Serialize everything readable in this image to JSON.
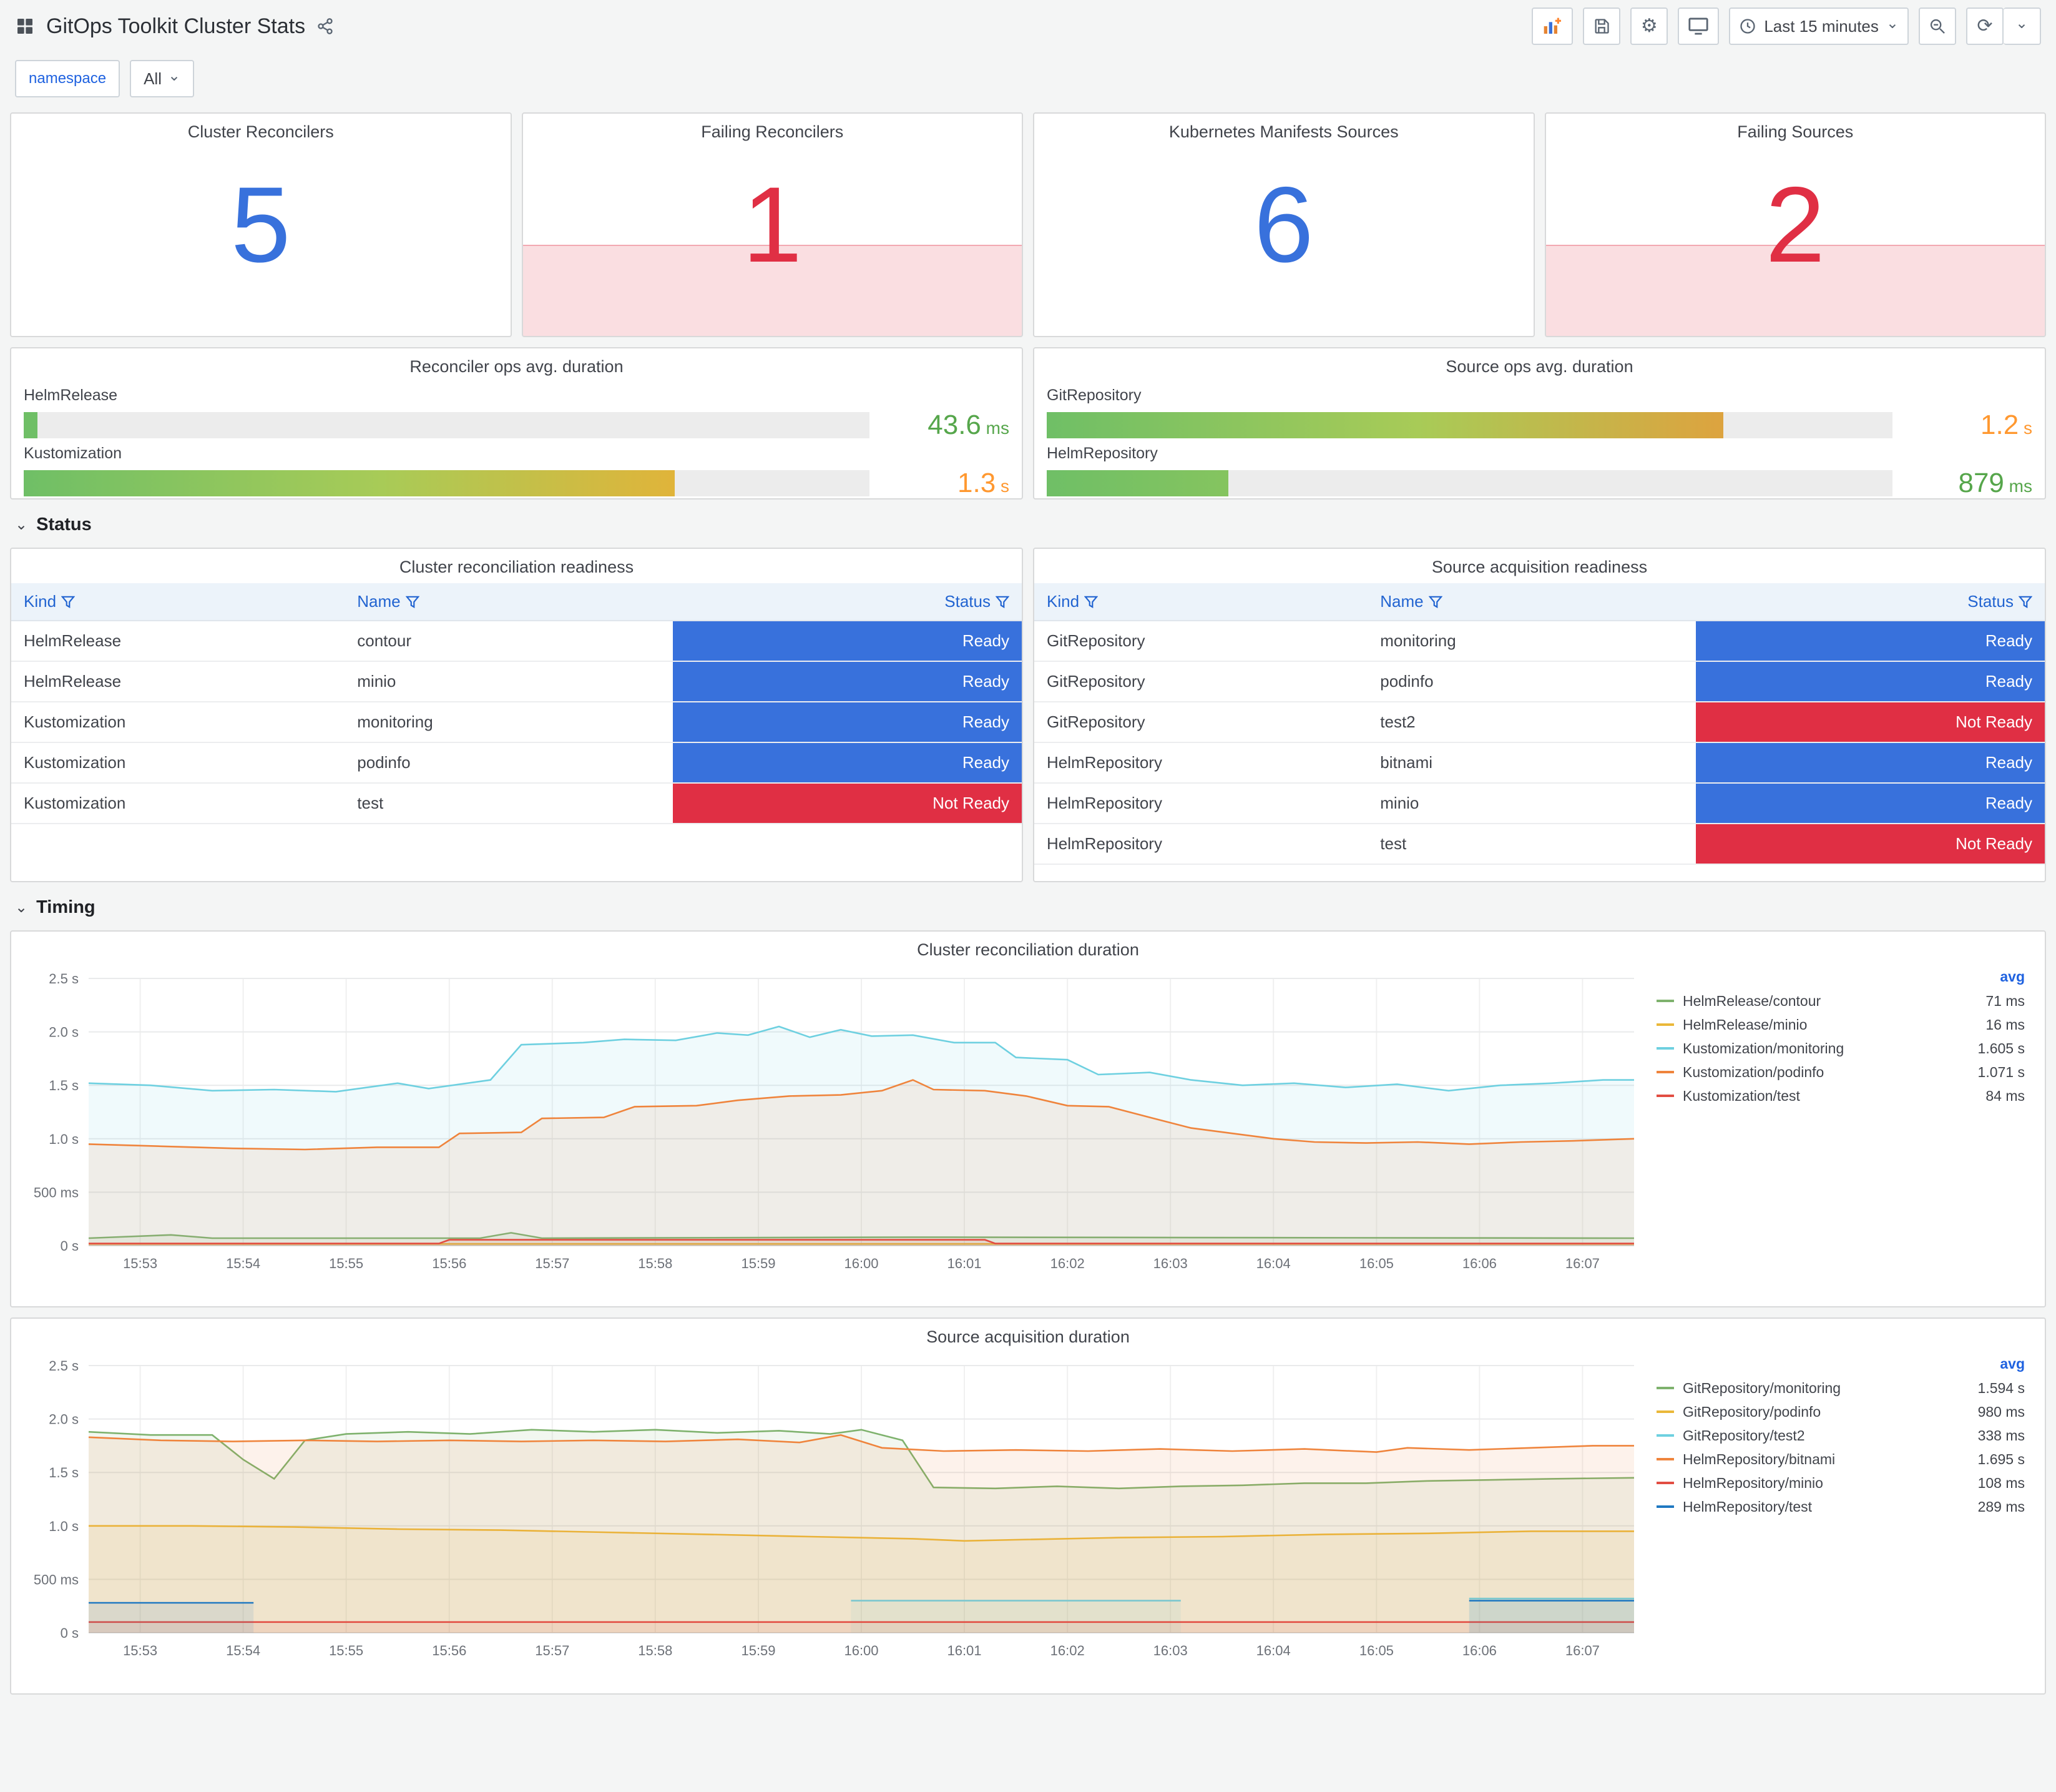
{
  "colors": {
    "blue": "#3871dc",
    "red": "#e02f44",
    "green_value": "#56a64b",
    "orange_value": "#ff9830",
    "ready_bg": "#3871dc",
    "not_ready_bg": "#e02f44"
  },
  "icons": {
    "grid": "dashboard-grid-icon",
    "share": "share-icon",
    "add_panel": "add-panel-icon",
    "save": "save-icon",
    "settings": "⚙",
    "kiosk": "tv-kiosk-icon",
    "clock": "clock-icon",
    "zoom_out": "zoom-out-icon",
    "refresh": "⟳",
    "chevron_down": "⌄",
    "filter": "filter-funnel-icon"
  },
  "header": {
    "title": "GitOps Toolkit Cluster Stats"
  },
  "toolbar": {
    "time_range": "Last 15 minutes"
  },
  "filters": {
    "namespace_label": "namespace",
    "namespace_value": "All"
  },
  "sections": {
    "status": "Status",
    "timing": "Timing"
  },
  "stat_panels": [
    {
      "title": "Cluster Reconcilers",
      "value": "5",
      "state": "ok"
    },
    {
      "title": "Failing Reconcilers",
      "value": "1",
      "state": "alert"
    },
    {
      "title": "Kubernetes Manifests Sources",
      "value": "6",
      "state": "ok"
    },
    {
      "title": "Failing Sources",
      "value": "2",
      "state": "alert"
    }
  ],
  "gauges": [
    {
      "title": "Reconciler ops avg. duration",
      "bars": [
        {
          "label": "HelmRelease",
          "value": "43.6",
          "unit": "ms",
          "pct": 1.6,
          "value_color": "#56a64b",
          "fill": "linear-gradient(90deg,#6fbf66,#6fbf66)"
        },
        {
          "label": "Kustomization",
          "value": "1.3",
          "unit": "s",
          "pct": 77,
          "value_color": "#ff9830",
          "fill": "linear-gradient(90deg,#6fbf66,#a8cb57 55%,#e0b43a 100%)"
        }
      ]
    },
    {
      "title": "Source ops avg. duration",
      "bars": [
        {
          "label": "GitRepository",
          "value": "1.2",
          "unit": "s",
          "pct": 80,
          "value_color": "#ff9830",
          "fill": "linear-gradient(90deg,#6fbf66,#a8cb57 55%,#dda33f 100%)"
        },
        {
          "label": "HelmRepository",
          "value": "879",
          "unit": "ms",
          "pct": 21.5,
          "value_color": "#56a64b",
          "fill": "linear-gradient(90deg,#6fbf66,#85c45f)"
        }
      ]
    }
  ],
  "status_section": {
    "tables": [
      {
        "title": "Cluster reconciliation readiness",
        "columns": [
          "Kind",
          "Name",
          "Status"
        ],
        "rows": [
          [
            "HelmRelease",
            "contour",
            "Ready"
          ],
          [
            "HelmRelease",
            "minio",
            "Ready"
          ],
          [
            "Kustomization",
            "monitoring",
            "Ready"
          ],
          [
            "Kustomization",
            "podinfo",
            "Ready"
          ],
          [
            "Kustomization",
            "test",
            "Not Ready"
          ]
        ]
      },
      {
        "title": "Source acquisition readiness",
        "columns": [
          "Kind",
          "Name",
          "Status"
        ],
        "rows": [
          [
            "GitRepository",
            "monitoring",
            "Ready"
          ],
          [
            "GitRepository",
            "podinfo",
            "Ready"
          ],
          [
            "GitRepository",
            "test2",
            "Not Ready"
          ],
          [
            "HelmRepository",
            "bitnami",
            "Ready"
          ],
          [
            "HelmRepository",
            "minio",
            "Ready"
          ],
          [
            "HelmRepository",
            "test",
            "Not Ready"
          ]
        ]
      }
    ]
  },
  "chart_data": [
    {
      "type": "line",
      "title": "Cluster reconciliation duration",
      "xlabel": "",
      "ylabel": "",
      "ylim": [
        0,
        2.5
      ],
      "grid": true,
      "legend_position": "right",
      "legend_header": "avg",
      "y_ticks": [
        {
          "v": 0,
          "label": "0 s"
        },
        {
          "v": 0.5,
          "label": "500 ms"
        },
        {
          "v": 1,
          "label": "1.0 s"
        },
        {
          "v": 1.5,
          "label": "1.5 s"
        },
        {
          "v": 2,
          "label": "2.0 s"
        },
        {
          "v": 2.5,
          "label": "2.5 s"
        }
      ],
      "x_tick_labels": [
        "15:53",
        "15:54",
        "15:55",
        "15:56",
        "15:57",
        "15:58",
        "15:59",
        "16:00",
        "16:01",
        "16:02",
        "16:03",
        "16:04",
        "16:05",
        "16:06",
        "16:07"
      ],
      "series": [
        {
          "name": "HelmRelease/contour",
          "color": "#7EB26D",
          "avg": "71 ms",
          "points": [
            [
              0,
              0.07
            ],
            [
              0.8,
              0.1
            ],
            [
              1.2,
              0.07
            ],
            [
              3.8,
              0.07
            ],
            [
              4.1,
              0.12
            ],
            [
              4.4,
              0.07
            ],
            [
              8,
              0.08
            ],
            [
              15,
              0.07
            ]
          ]
        },
        {
          "name": "HelmRelease/minio",
          "color": "#EAB839",
          "avg": "16 ms",
          "points": [
            [
              0,
              0.016
            ],
            [
              15,
              0.016
            ]
          ]
        },
        {
          "name": "Kustomization/monitoring",
          "color": "#6ED0E0",
          "avg": "1.605 s",
          "points": [
            [
              0,
              1.52
            ],
            [
              0.6,
              1.5
            ],
            [
              1.2,
              1.45
            ],
            [
              1.8,
              1.46
            ],
            [
              2.4,
              1.44
            ],
            [
              3,
              1.52
            ],
            [
              3.3,
              1.47
            ],
            [
              3.9,
              1.55
            ],
            [
              4.2,
              1.88
            ],
            [
              4.8,
              1.9
            ],
            [
              5.2,
              1.93
            ],
            [
              5.7,
              1.92
            ],
            [
              6.1,
              1.99
            ],
            [
              6.4,
              1.97
            ],
            [
              6.7,
              2.05
            ],
            [
              7,
              1.95
            ],
            [
              7.3,
              2.02
            ],
            [
              7.6,
              1.96
            ],
            [
              8,
              1.97
            ],
            [
              8.4,
              1.9
            ],
            [
              8.8,
              1.9
            ],
            [
              9,
              1.76
            ],
            [
              9.5,
              1.74
            ],
            [
              9.8,
              1.6
            ],
            [
              10.3,
              1.62
            ],
            [
              10.7,
              1.55
            ],
            [
              11.2,
              1.5
            ],
            [
              11.7,
              1.52
            ],
            [
              12.2,
              1.48
            ],
            [
              12.7,
              1.51
            ],
            [
              13.2,
              1.45
            ],
            [
              13.7,
              1.5
            ],
            [
              14.2,
              1.52
            ],
            [
              14.7,
              1.55
            ],
            [
              15,
              1.55
            ]
          ]
        },
        {
          "name": "Kustomization/podinfo",
          "color": "#EF843C",
          "avg": "1.071 s",
          "points": [
            [
              0,
              0.95
            ],
            [
              0.7,
              0.93
            ],
            [
              1.4,
              0.91
            ],
            [
              2.1,
              0.9
            ],
            [
              2.8,
              0.92
            ],
            [
              3.4,
              0.92
            ],
            [
              3.6,
              1.05
            ],
            [
              4.2,
              1.06
            ],
            [
              4.4,
              1.19
            ],
            [
              5,
              1.2
            ],
            [
              5.3,
              1.3
            ],
            [
              5.9,
              1.31
            ],
            [
              6.3,
              1.36
            ],
            [
              6.8,
              1.4
            ],
            [
              7.3,
              1.41
            ],
            [
              7.7,
              1.45
            ],
            [
              8,
              1.55
            ],
            [
              8.2,
              1.46
            ],
            [
              8.7,
              1.45
            ],
            [
              9.1,
              1.4
            ],
            [
              9.5,
              1.31
            ],
            [
              9.9,
              1.3
            ],
            [
              10.3,
              1.2
            ],
            [
              10.7,
              1.1
            ],
            [
              11.1,
              1.05
            ],
            [
              11.5,
              1
            ],
            [
              11.9,
              0.97
            ],
            [
              12.4,
              0.96
            ],
            [
              12.9,
              0.97
            ],
            [
              13.4,
              0.95
            ],
            [
              13.9,
              0.97
            ],
            [
              14.4,
              0.98
            ],
            [
              15,
              1
            ]
          ]
        },
        {
          "name": "Kustomization/test",
          "color": "#E24D42",
          "avg": "84 ms",
          "points": [
            [
              0,
              0.02
            ],
            [
              3.4,
              0.02
            ],
            [
              3.5,
              0.055
            ],
            [
              8.7,
              0.055
            ],
            [
              8.8,
              0.02
            ],
            [
              15,
              0.02
            ]
          ]
        }
      ]
    },
    {
      "type": "line",
      "title": "Source acquisition duration",
      "xlabel": "",
      "ylabel": "",
      "ylim": [
        0,
        2.5
      ],
      "grid": true,
      "legend_position": "right",
      "legend_header": "avg",
      "y_ticks": [
        {
          "v": 0,
          "label": "0 s"
        },
        {
          "v": 0.5,
          "label": "500 ms"
        },
        {
          "v": 1,
          "label": "1.0 s"
        },
        {
          "v": 1.5,
          "label": "1.5 s"
        },
        {
          "v": 2,
          "label": "2.0 s"
        },
        {
          "v": 2.5,
          "label": "2.5 s"
        }
      ],
      "x_tick_labels": [
        "15:53",
        "15:54",
        "15:55",
        "15:56",
        "15:57",
        "15:58",
        "15:59",
        "16:00",
        "16:01",
        "16:02",
        "16:03",
        "16:04",
        "16:05",
        "16:06",
        "16:07"
      ],
      "series": [
        {
          "name": "GitRepository/monitoring",
          "color": "#7EB26D",
          "avg": "1.594 s",
          "points": [
            [
              0,
              1.88
            ],
            [
              0.6,
              1.85
            ],
            [
              1.2,
              1.85
            ],
            [
              1.5,
              1.62
            ],
            [
              1.8,
              1.44
            ],
            [
              2.1,
              1.8
            ],
            [
              2.5,
              1.86
            ],
            [
              3.1,
              1.88
            ],
            [
              3.7,
              1.86
            ],
            [
              4.3,
              1.9
            ],
            [
              4.9,
              1.88
            ],
            [
              5.5,
              1.9
            ],
            [
              6.1,
              1.87
            ],
            [
              6.7,
              1.89
            ],
            [
              7.2,
              1.86
            ],
            [
              7.5,
              1.9
            ],
            [
              7.9,
              1.8
            ],
            [
              8.2,
              1.36
            ],
            [
              8.8,
              1.35
            ],
            [
              9.4,
              1.37
            ],
            [
              10,
              1.35
            ],
            [
              10.6,
              1.37
            ],
            [
              11.2,
              1.38
            ],
            [
              11.8,
              1.4
            ],
            [
              12.4,
              1.4
            ],
            [
              13,
              1.42
            ],
            [
              13.6,
              1.43
            ],
            [
              14.2,
              1.44
            ],
            [
              15,
              1.45
            ]
          ]
        },
        {
          "name": "GitRepository/podinfo",
          "color": "#EAB839",
          "avg": "980 ms",
          "points": [
            [
              0,
              1
            ],
            [
              1,
              1
            ],
            [
              2,
              0.99
            ],
            [
              3,
              0.97
            ],
            [
              4,
              0.96
            ],
            [
              5,
              0.94
            ],
            [
              6,
              0.92
            ],
            [
              7,
              0.9
            ],
            [
              8,
              0.88
            ],
            [
              8.5,
              0.86
            ],
            [
              9,
              0.87
            ],
            [
              10,
              0.89
            ],
            [
              11,
              0.9
            ],
            [
              12,
              0.92
            ],
            [
              13,
              0.93
            ],
            [
              14,
              0.95
            ],
            [
              15,
              0.95
            ]
          ]
        },
        {
          "name": "GitRepository/test2",
          "color": "#6ED0E0",
          "avg": "338 ms",
          "points": [
            [
              7.4,
              0.3
            ],
            [
              10.6,
              0.3
            ],
            [
              10.7,
              null
            ],
            [
              13.4,
              0.32
            ],
            [
              15,
              0.32
            ]
          ]
        },
        {
          "name": "HelmRepository/bitnami",
          "color": "#EF843C",
          "avg": "1.695 s",
          "points": [
            [
              0,
              1.83
            ],
            [
              0.7,
              1.8
            ],
            [
              1.4,
              1.79
            ],
            [
              2.1,
              1.8
            ],
            [
              2.8,
              1.79
            ],
            [
              3.5,
              1.8
            ],
            [
              4.2,
              1.79
            ],
            [
              4.9,
              1.8
            ],
            [
              5.6,
              1.79
            ],
            [
              6.3,
              1.81
            ],
            [
              6.9,
              1.78
            ],
            [
              7.3,
              1.85
            ],
            [
              7.7,
              1.73
            ],
            [
              8.3,
              1.7
            ],
            [
              9,
              1.71
            ],
            [
              9.7,
              1.7
            ],
            [
              10.4,
              1.72
            ],
            [
              11.1,
              1.7
            ],
            [
              11.8,
              1.72
            ],
            [
              12.5,
              1.69
            ],
            [
              12.8,
              1.73
            ],
            [
              13.4,
              1.71
            ],
            [
              14,
              1.73
            ],
            [
              14.6,
              1.75
            ],
            [
              15,
              1.75
            ]
          ]
        },
        {
          "name": "HelmRepository/minio",
          "color": "#E24D42",
          "avg": "108 ms",
          "points": [
            [
              0,
              0.1
            ],
            [
              15,
              0.1
            ]
          ]
        },
        {
          "name": "HelmRepository/test",
          "color": "#1F78C1",
          "avg": "289 ms",
          "points": [
            [
              0,
              0.28
            ],
            [
              1.6,
              0.28
            ],
            [
              1.7,
              null
            ],
            [
              13.4,
              0.3
            ],
            [
              15,
              0.3
            ]
          ]
        }
      ]
    }
  ]
}
